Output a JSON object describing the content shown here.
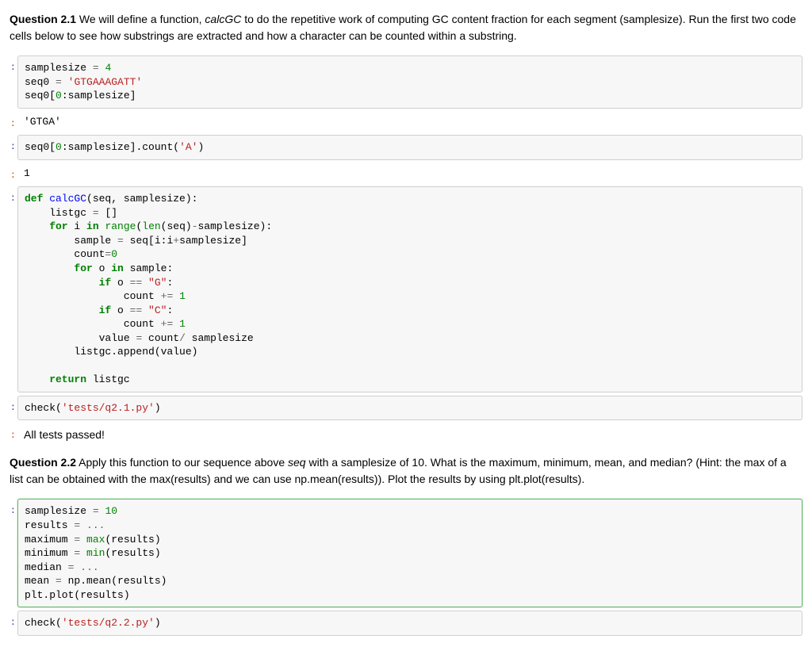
{
  "q21": {
    "label": "Question 2.1",
    "text_a": " We will define a function, ",
    "func": "calcGC",
    "text_b": " to do the repetitive work of computing GC content fraction for each segment (samplesize). Run the first two code cells below to see how substrings are extracted and how a character can be counted within a substring."
  },
  "q22": {
    "label": "Question 2.2",
    "text_a": " Apply this function to our sequence above ",
    "var": "seq",
    "text_b": " with a samplesize of 10. What is the maximum, minimum, mean, and median? (Hint: the max of a list can be obtained with the max(results) and we can use np.mean(results)). Plot the results by using plt.plot(results)."
  },
  "cell1": {
    "l1a": "samplesize ",
    "l1b": "=",
    "l1c": " ",
    "l1d": "4",
    "l2a": "seq0 ",
    "l2b": "=",
    "l2c": " ",
    "l2d": "'GTGAAAGATT'",
    "l3a": "seq0[",
    "l3b": "0",
    "l3c": ":samplesize]"
  },
  "out1": "'GTGA'",
  "cell2": {
    "t": "seq0[",
    "z": "0",
    "m": ":samplesize].count(",
    "s": "'A'",
    "e": ")"
  },
  "out2": "1",
  "cell3": {
    "l1_def": "def",
    "l1_name": " calcGC",
    "l1_rest": "(seq, samplesize):",
    "l2": "    listgc ",
    "l2eq": "=",
    "l2b": " []",
    "l3_for": "    for",
    "l3a": " i ",
    "l3_in": "in",
    "l3b": " ",
    "l3_range": "range",
    "l3c": "(",
    "l3_len": "len",
    "l3d": "(seq)",
    "l3_minus": "-",
    "l3e": "samplesize):",
    "l4a": "        sample ",
    "l4eq": "=",
    "l4b": " seq[i:i",
    "l4plus": "+",
    "l4c": "samplesize]",
    "l5a": "        count",
    "l5eq": "=",
    "l5z": "0",
    "l6_for": "        for",
    "l6a": " o ",
    "l6_in": "in",
    "l6b": " sample:",
    "l7_if": "            if",
    "l7a": " o ",
    "l7_eq": "==",
    "l7b": " ",
    "l7_s": "\"G\"",
    "l7c": ":",
    "l8a": "                count ",
    "l8op": "+=",
    "l8b": " ",
    "l8n": "1",
    "l9_if": "            if",
    "l9a": " o ",
    "l9_eq": "==",
    "l9b": " ",
    "l9_s": "\"C\"",
    "l9c": ":",
    "l10a": "                count ",
    "l10op": "+=",
    "l10b": " ",
    "l10n": "1",
    "l11a": "            value ",
    "l11eq": "=",
    "l11b": " count",
    "l11div": "/",
    "l11c": " samplesize",
    "l12": "        listgc.append(value)",
    "l13": "",
    "l14_ret": "    return",
    "l14a": " listgc"
  },
  "cell4": {
    "a": "check(",
    "s": "'tests/q2.1.py'",
    "b": ")"
  },
  "out4": "All tests passed!",
  "cell5": {
    "l1a": "samplesize ",
    "l1eq": "=",
    "l1b": " ",
    "l1n": "10",
    "l2a": "results ",
    "l2eq": "=",
    "l2b": " ",
    "l2d": "...",
    "l3a": "maximum ",
    "l3eq": "=",
    "l3b": " ",
    "l3fn": "max",
    "l3c": "(results)",
    "l4a": "minimum ",
    "l4eq": "=",
    "l4b": " ",
    "l4fn": "min",
    "l4c": "(results)",
    "l5a": "median ",
    "l5eq": "=",
    "l5b": " ",
    "l5d": "...",
    "l6a": "mean ",
    "l6eq": "=",
    "l6b": " np.mean(results)",
    "l7a": "plt.plot(results)"
  },
  "cell6": {
    "a": "check(",
    "s": "'tests/q2.2.py'",
    "b": ")"
  }
}
